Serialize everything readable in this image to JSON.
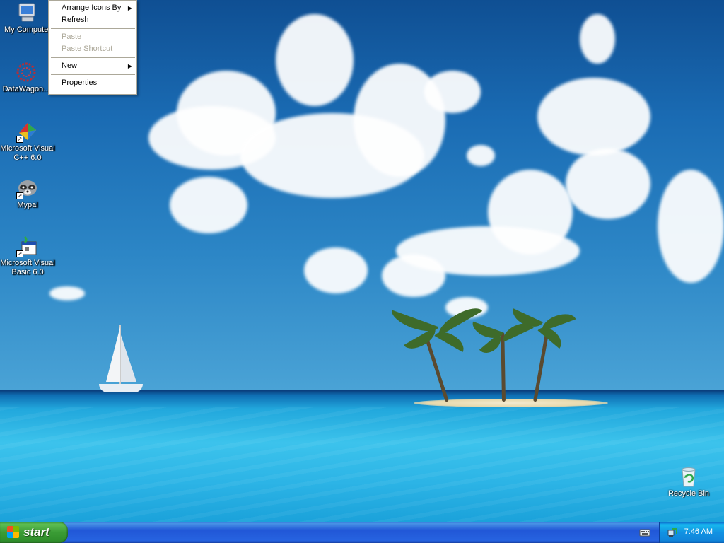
{
  "desktop": {
    "icons": [
      {
        "label": "My Computer",
        "icon": "my-computer-icon"
      },
      {
        "label": "DataWagon...",
        "icon": "datawagon-icon"
      },
      {
        "label": "Microsoft Visual C++ 6.0",
        "icon": "visual-cpp-icon"
      },
      {
        "label": "Mypal",
        "icon": "mypal-raccoon-icon"
      },
      {
        "label": "Microsoft Visual Basic 6.0",
        "icon": "visual-basic-icon"
      },
      {
        "label": "Recycle Bin",
        "icon": "recycle-bin-icon"
      }
    ]
  },
  "context_menu": {
    "arrange_icons_by": "Arrange Icons By",
    "refresh": "Refresh",
    "paste": "Paste",
    "paste_shortcut": "Paste Shortcut",
    "new": "New",
    "properties": "Properties"
  },
  "taskbar": {
    "start_label": "start",
    "clock": "7:46 AM"
  },
  "colors": {
    "taskbar_blue": "#2157d7",
    "start_green": "#3a9c35",
    "tray_blue": "#1192e3",
    "menu_disabled": "#aca899"
  }
}
